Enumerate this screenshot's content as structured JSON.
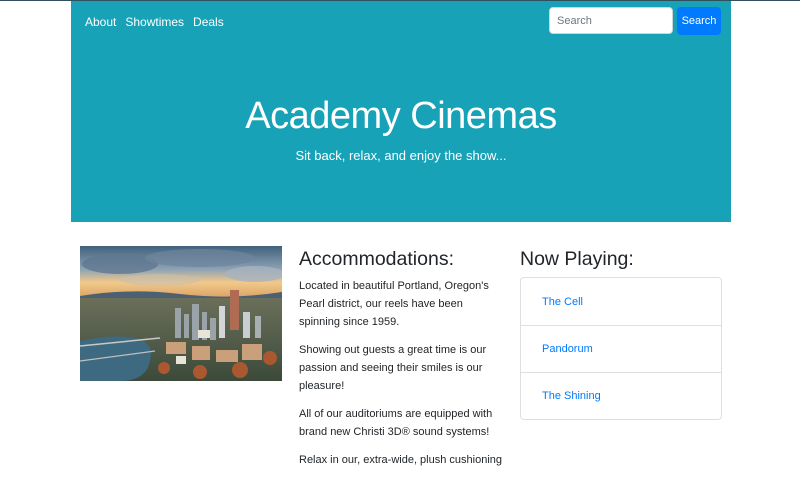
{
  "nav": {
    "links": [
      "About",
      "Showtimes",
      "Deals"
    ],
    "search_placeholder": "Search",
    "search_button": "Search"
  },
  "hero": {
    "title": "Academy Cinemas",
    "subtitle": "Sit back, relax, and enjoy the show..."
  },
  "accommodations": {
    "heading": "Accommodations:",
    "paragraphs": [
      "Located in beautiful Portland, Oregon's Pearl district, our reels have been spinning since 1959.",
      "Showing out guests a great time is our passion and seeing their smiles is our pleasure!",
      "All of our auditoriums are equipped with brand new Christi 3D® sound systems!",
      "Relax in our, extra-wide, plush cushioning"
    ]
  },
  "now_playing": {
    "heading": "Now Playing:",
    "movies": [
      "The Cell",
      "Pandorum",
      "The Shining"
    ]
  },
  "colors": {
    "hero_bg": "#17a2b8",
    "primary": "#007bff"
  }
}
